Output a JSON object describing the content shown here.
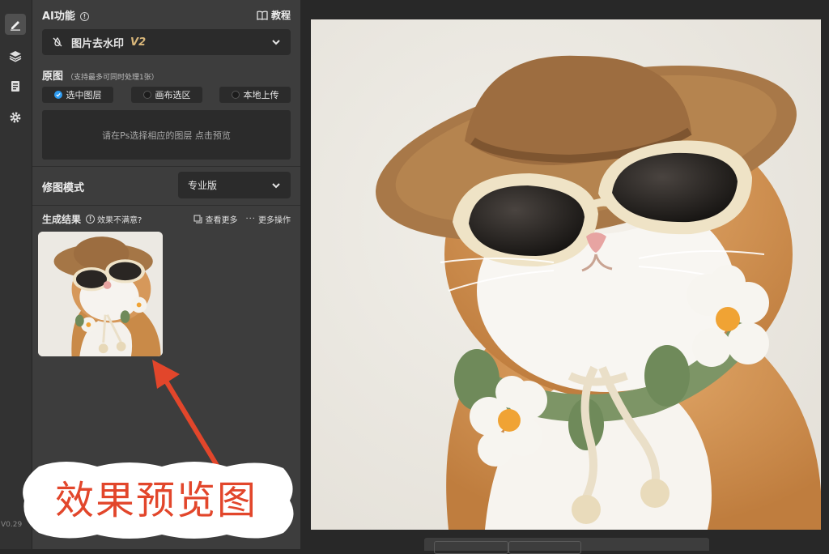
{
  "sidebar": {
    "version": "V0.29"
  },
  "panel": {
    "ai_title": "AI功能",
    "tutorial_label": "教程",
    "feature": {
      "label": "图片去水印",
      "badge": "V2"
    },
    "source": {
      "title": "原图",
      "hint": "（支持最多可同时处理1张）",
      "options": [
        "选中图层",
        "画布选区",
        "本地上传"
      ],
      "selected": "选中图层",
      "drop_hint": "请在Ps选择相应的图层 点击预览"
    },
    "mode": {
      "label": "修图模式",
      "value": "专业版"
    },
    "results": {
      "title": "生成结果",
      "unsatisfied": "效果不满意?",
      "view_more": "查看更多",
      "more_actions": "更多操作"
    }
  },
  "annotation": {
    "text": "效果预览图",
    "color": "#e2462b"
  },
  "colors": {
    "accent": "#2e9bf0",
    "badge": "#d9b77a",
    "panel_bg": "#3d3d3d",
    "field_bg": "#2b2b2b"
  }
}
